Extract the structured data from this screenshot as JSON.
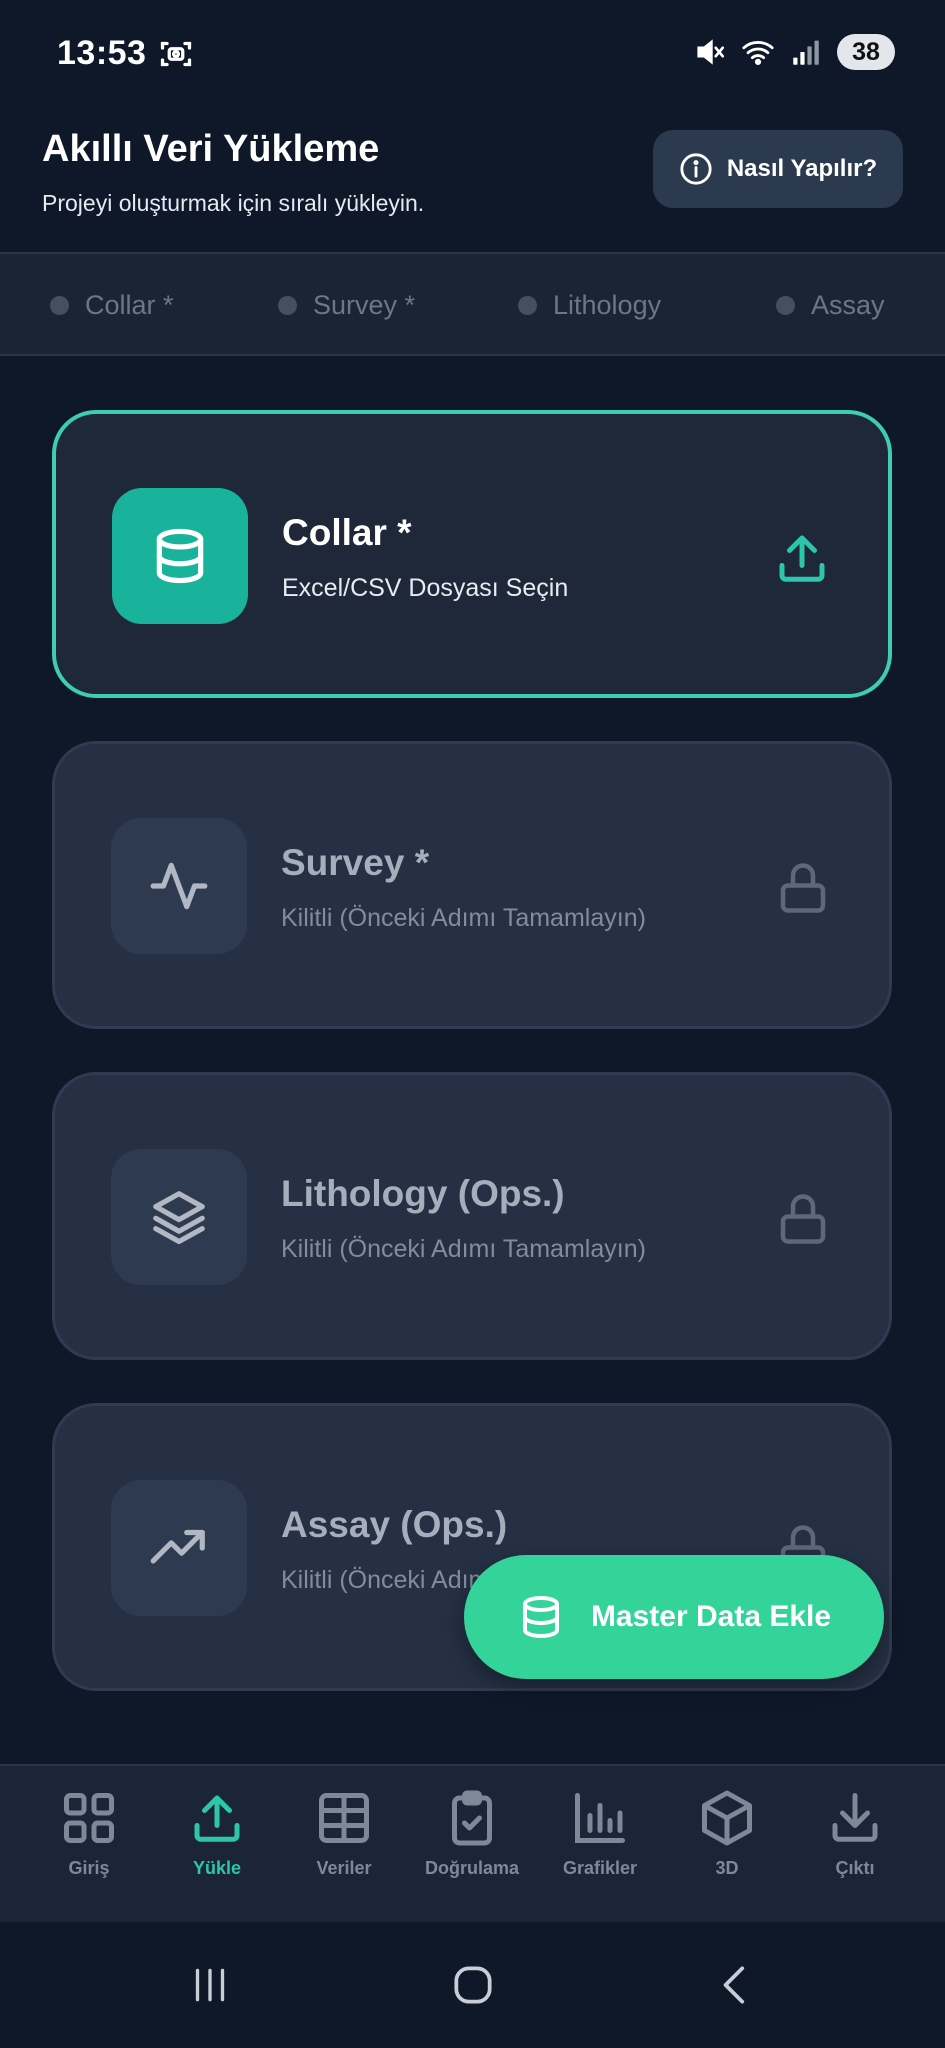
{
  "status_bar": {
    "time": "13:53",
    "battery": "38"
  },
  "header": {
    "title": "Akıllı Veri Yükleme",
    "subtitle": "Projeyi oluşturmak için sıralı yükleyin.",
    "howto_label": "Nasıl Yapılır?"
  },
  "steps": [
    {
      "label": "Collar *"
    },
    {
      "label": "Survey *"
    },
    {
      "label": "Lithology"
    },
    {
      "label": "Assay"
    }
  ],
  "cards": [
    {
      "title": "Collar *",
      "desc": "Excel/CSV Dosyası Seçin",
      "icon": "database-icon",
      "action_icon": "upload-icon",
      "state": "active"
    },
    {
      "title": "Survey *",
      "desc": "Kilitli (Önceki Adımı Tamamlayın)",
      "icon": "activity-icon",
      "action_icon": "lock-icon",
      "state": "locked"
    },
    {
      "title": "Lithology (Ops.)",
      "desc": "Kilitli (Önceki Adımı Tamamlayın)",
      "icon": "layers-icon",
      "action_icon": "lock-icon",
      "state": "locked"
    },
    {
      "title": "Assay (Ops.)",
      "desc": "Kilitli (Önceki Adımı Tamamlayın)",
      "icon": "trending-up-icon",
      "action_icon": "lock-icon",
      "state": "locked"
    }
  ],
  "fab": {
    "label": "Master Data Ekle",
    "icon": "database-icon"
  },
  "bottom_nav": {
    "active": "Yükle",
    "items": [
      {
        "label": "Giriş",
        "icon": "grid-icon"
      },
      {
        "label": "Yükle",
        "icon": "upload-icon"
      },
      {
        "label": "Veriler",
        "icon": "table-icon"
      },
      {
        "label": "Doğrulama",
        "icon": "clipboard-check-icon"
      },
      {
        "label": "Grafikler",
        "icon": "bar-chart-icon"
      },
      {
        "label": "3D",
        "icon": "cube-icon"
      },
      {
        "label": "Çıktı",
        "icon": "download-icon"
      }
    ]
  },
  "colors": {
    "background": "#0f1829",
    "accent": "#3ccdb4",
    "fab": "#34d399",
    "card": "#253044"
  }
}
